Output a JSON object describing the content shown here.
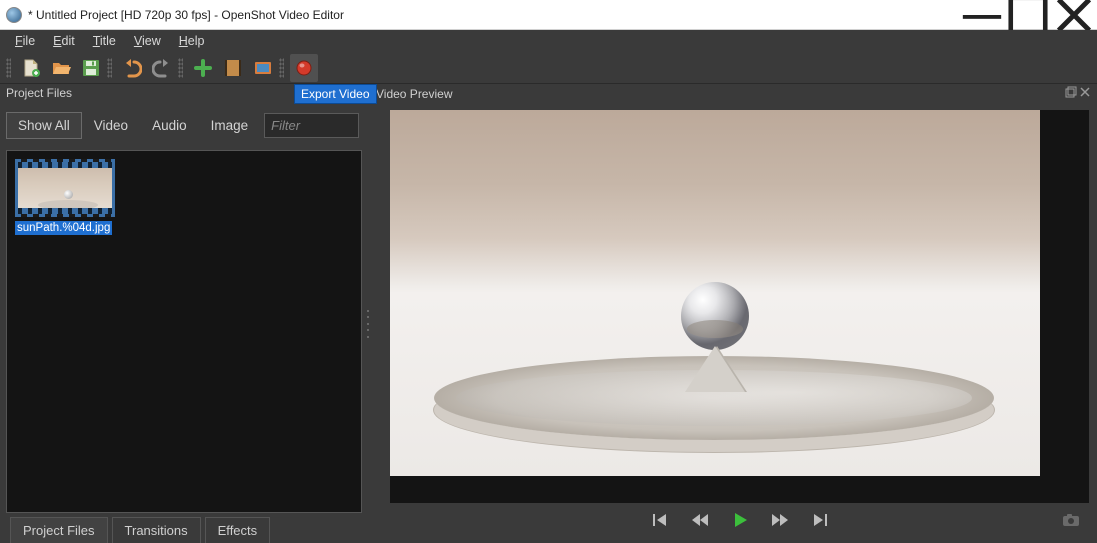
{
  "titlebar": {
    "title": "* Untitled Project [HD 720p 30 fps] - OpenShot Video Editor"
  },
  "menu": {
    "file": "File",
    "edit": "Edit",
    "title_menu": "Title",
    "view": "View",
    "help": "Help"
  },
  "tooltip": {
    "export_video": "Export Video"
  },
  "panel_titles": {
    "project_files": "Project Files",
    "video_preview": "Video Preview"
  },
  "filters": {
    "show_all": "Show All",
    "video": "Video",
    "audio": "Audio",
    "image": "Image",
    "placeholder": "Filter"
  },
  "files": {
    "item0_label": "sunPath.%04d.jpg"
  },
  "bottom_tabs": {
    "project_files": "Project Files",
    "transitions": "Transitions",
    "effects": "Effects"
  }
}
